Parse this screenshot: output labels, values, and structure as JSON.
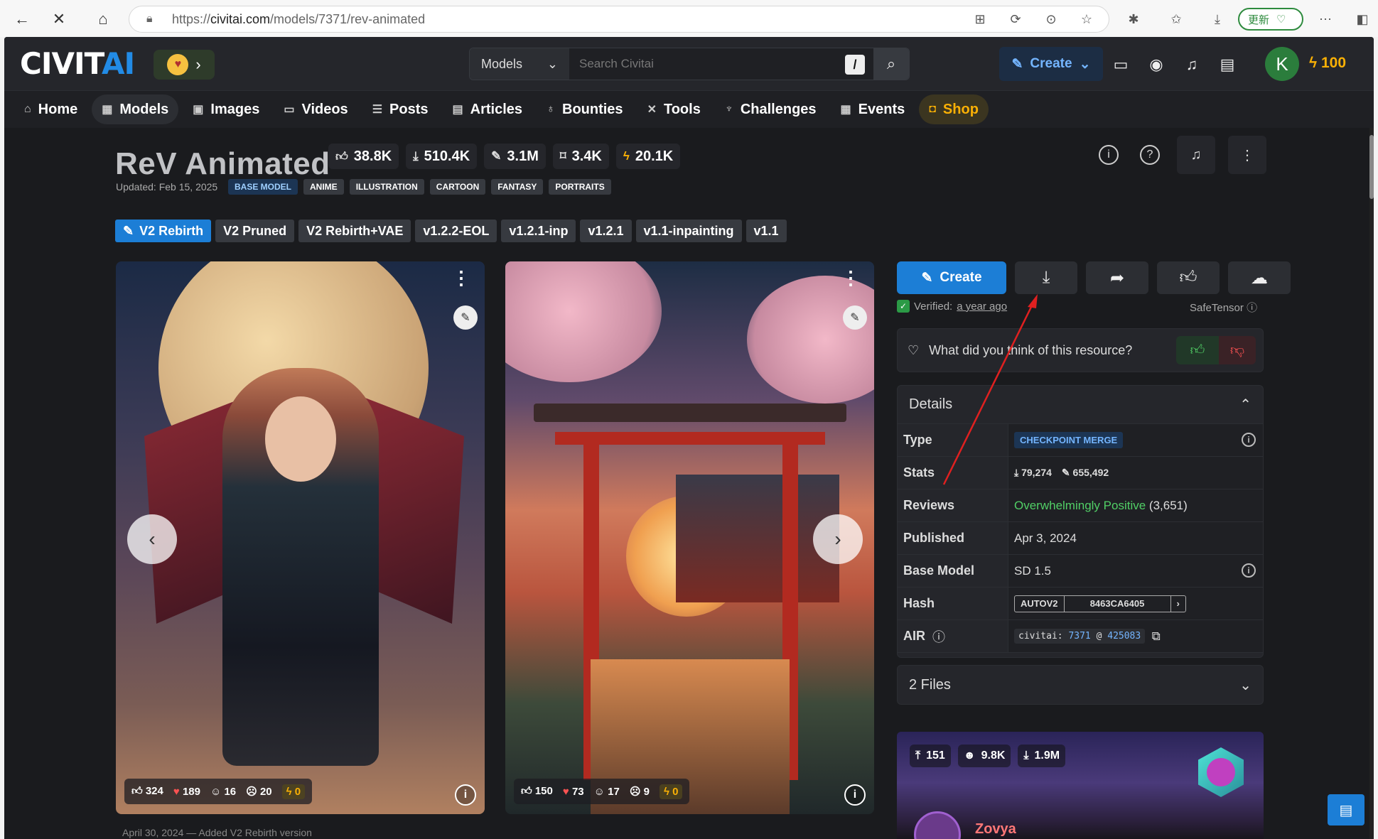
{
  "browser": {
    "url_prefix": "https://",
    "url_domain": "civitai.com",
    "url_path": "/models/7371/rev-animated",
    "update_label": "更新"
  },
  "topbar": {
    "logo_civ": "CIVIT",
    "logo_ai": "AI",
    "search_category": "Models",
    "search_placeholder": "Search Civitai",
    "search_shortcut": "/",
    "create_label": "Create",
    "avatar_letter": "K",
    "buzz_amount": "100"
  },
  "nav": [
    {
      "label": "Home",
      "icon": "home-icon",
      "glyph": "⌂"
    },
    {
      "label": "Models",
      "icon": "grid-icon",
      "glyph": "▦"
    },
    {
      "label": "Images",
      "icon": "image-icon",
      "glyph": "▣"
    },
    {
      "label": "Videos",
      "icon": "video-icon",
      "glyph": "▭"
    },
    {
      "label": "Posts",
      "icon": "posts-icon",
      "glyph": "☰"
    },
    {
      "label": "Articles",
      "icon": "article-icon",
      "glyph": "▤"
    },
    {
      "label": "Bounties",
      "icon": "bag-icon",
      "glyph": "♁"
    },
    {
      "label": "Tools",
      "icon": "tools-icon",
      "glyph": "✕"
    },
    {
      "label": "Challenges",
      "icon": "trophy-icon",
      "glyph": "♆"
    },
    {
      "label": "Events",
      "icon": "calendar-icon",
      "glyph": "▦"
    },
    {
      "label": "Shop",
      "icon": "shop-icon",
      "glyph": "◘"
    }
  ],
  "model": {
    "title": "ReV Animated",
    "stats": {
      "likes": "38.8K",
      "downloads": "510.4K",
      "generations": "3.1M",
      "bookmarks": "3.4K",
      "buzz": "20.1K"
    },
    "updated": "Updated: Feb 15, 2025",
    "tags": [
      "BASE MODEL",
      "ANIME",
      "ILLUSTRATION",
      "CARTOON",
      "FANTASY",
      "PORTRAITS"
    ],
    "versions": [
      "V2 Rebirth",
      "V2 Pruned",
      "V2 Rebirth+VAE",
      "v1.2.2-EOL",
      "v1.2.1-inp",
      "v1.2.1",
      "v1.1-inpainting",
      "v1.1"
    ]
  },
  "images": [
    {
      "reactions": {
        "like": "324",
        "heart": "189",
        "laugh": "16",
        "cry": "20",
        "buzz": "0"
      }
    },
    {
      "reactions": {
        "like": "150",
        "heart": "73",
        "laugh": "17",
        "cry": "9",
        "buzz": "0"
      }
    }
  ],
  "panel": {
    "create_label": "Create",
    "verified_label": "Verified:",
    "verified_time": "a year ago",
    "safetensor": "SafeTensor",
    "feedback_q": "What did you think of this resource?",
    "details_title": "Details",
    "rows": {
      "type_k": "Type",
      "type_v": "CHECKPOINT MERGE",
      "stats_k": "Stats",
      "stats_dl": "79,274",
      "stats_gen": "655,492",
      "reviews_k": "Reviews",
      "reviews_v": "Overwhelmingly Positive",
      "reviews_n": "(3,651)",
      "published_k": "Published",
      "published_v": "Apr 3, 2024",
      "base_k": "Base Model",
      "base_v": "SD 1.5",
      "hash_k": "Hash",
      "hash_type": "AUTOV2",
      "hash_v": "8463CA6405",
      "air_k": "AIR",
      "air_prefix": "civitai:",
      "air_id": "7371",
      "air_at": "@",
      "air_ver": "425083"
    },
    "files_label": "2 Files",
    "creator": {
      "uploads": "151",
      "followers": "9.8K",
      "downloads": "1.9M",
      "name": "Zovya"
    }
  },
  "footer_text": "April 30, 2024 — Added V2 Rebirth version"
}
